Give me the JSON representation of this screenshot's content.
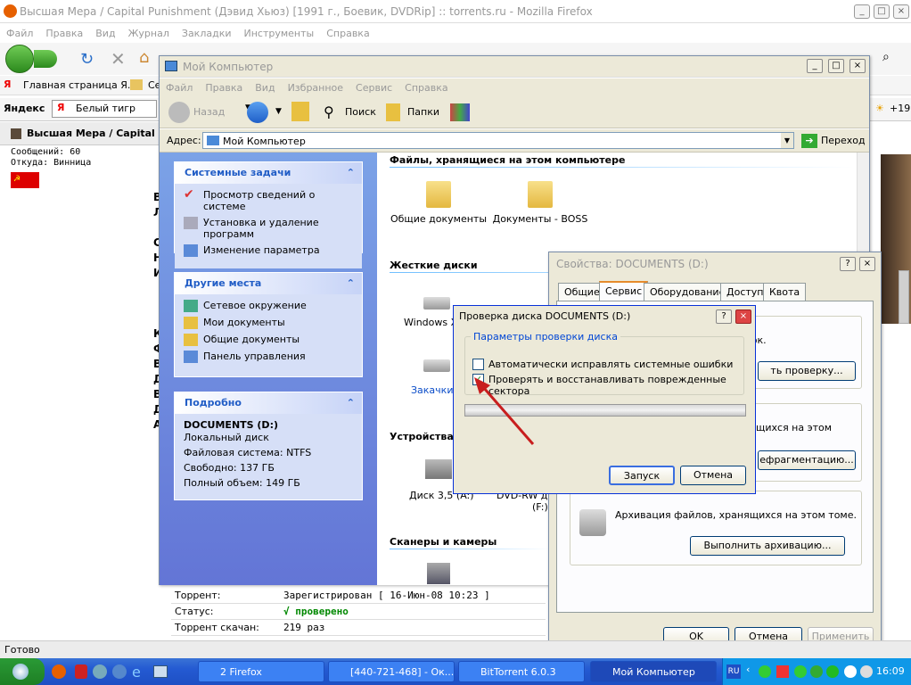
{
  "firefox": {
    "title": "Высшая Мера / Capital Punishment (Дэвид Хьюз) [1991 г., Боевик, DVDRip] :: torrents.ru - Mozilla Firefox",
    "menu": [
      "Файл",
      "Правка",
      "Вид",
      "Журнал",
      "Закладки",
      "Инструменты",
      "Справка"
    ],
    "bookmark1": "Главная страница Я...",
    "bookmark2": "Се",
    "yandex_label": "Яндекс",
    "yandex_field": "Белый тигр",
    "weather": "+19",
    "tab_label": "Высшая Мера / Capital Pu",
    "status": "Готово"
  },
  "webpage": {
    "messages": "Сообщений: 60",
    "from": "Откуда: Винница",
    "letters": [
      "В",
      "Л",
      "С",
      "Н",
      "И",
      "К",
      "Ф",
      "В",
      "Д",
      "В",
      "Д",
      "А"
    ],
    "torrent_rows": [
      {
        "label": "Торрент:",
        "value": "Зарегистрирован  [ 16-Июн-08 10:23 ]"
      },
      {
        "label": "Статус:",
        "value": "√ проверено"
      },
      {
        "label": "Торрент скачан:",
        "value": "219 раз"
      }
    ]
  },
  "explorer": {
    "title": "Мой Компьютер",
    "menu": [
      "Файл",
      "Правка",
      "Вид",
      "Избранное",
      "Сервис",
      "Справка"
    ],
    "back": "Назад",
    "search": "Поиск",
    "folders": "Папки",
    "address_label": "Адрес:",
    "address_value": "Мой Компьютер",
    "go": "Переход",
    "system_tasks": {
      "header": "Системные задачи",
      "items": [
        "Просмотр сведений о системе",
        "Установка и удаление программ",
        "Изменение параметра"
      ]
    },
    "other_places": {
      "header": "Другие места",
      "items": [
        "Сетевое окружение",
        "Мои документы",
        "Общие документы",
        "Панель управления"
      ]
    },
    "details": {
      "header": "Подробно",
      "name": "DOCUMENTS (D:)",
      "type": "Локальный диск",
      "fs": "Файловая система: NTFS",
      "free": "Свободно: 137 ГБ",
      "total": "Полный объем: 149 ГБ"
    },
    "sections": {
      "files": "Файлы, хранящиеся на этом компьютере",
      "disks": "Жесткие диски",
      "devices": "Устройства",
      "scanners": "Сканеры и камеры"
    },
    "shared_docs": "Общие документы",
    "boss_docs": "Документы - BOSS",
    "drive_c": "Windows XP",
    "drive_zak": "Закачки",
    "floppy": "Диск 3,5 (A:)",
    "dvd": "DVD-RW ди",
    "dvd2": "(F:)"
  },
  "properties": {
    "title": "Свойства: DOCUMENTS (D:)",
    "tabs": [
      "Общие",
      "Сервис",
      "Оборудование",
      "Доступ",
      "Квота"
    ],
    "check_text": "бок.",
    "check_btn": "ть проверку...",
    "defrag_text1": "щихся на этом",
    "defrag_btn": "ефрагментацию...",
    "backup_text": "Архивация файлов, хранящихся на этом томе.",
    "backup_btn": "Выполнить архивацию...",
    "ok": "OK",
    "cancel": "Отмена",
    "apply": "Применить"
  },
  "checkdisk": {
    "title": "Проверка диска DOCUMENTS (D:)",
    "group": "Параметры проверки диска",
    "opt1": "Автоматически исправлять системные ошибки",
    "opt2": "Проверять и восстанавливать поврежденные сектора",
    "opt1_checked": false,
    "opt2_checked": true,
    "start": "Запуск",
    "cancel": "Отмена"
  },
  "taskbar": {
    "firefox": "2 Firefox",
    "ok": "[440-721-468] - Ок...",
    "bittorrent": "BitTorrent 6.0.3",
    "mycomp": "Мой Компьютер",
    "lang": "RU",
    "clock": "16:09"
  }
}
